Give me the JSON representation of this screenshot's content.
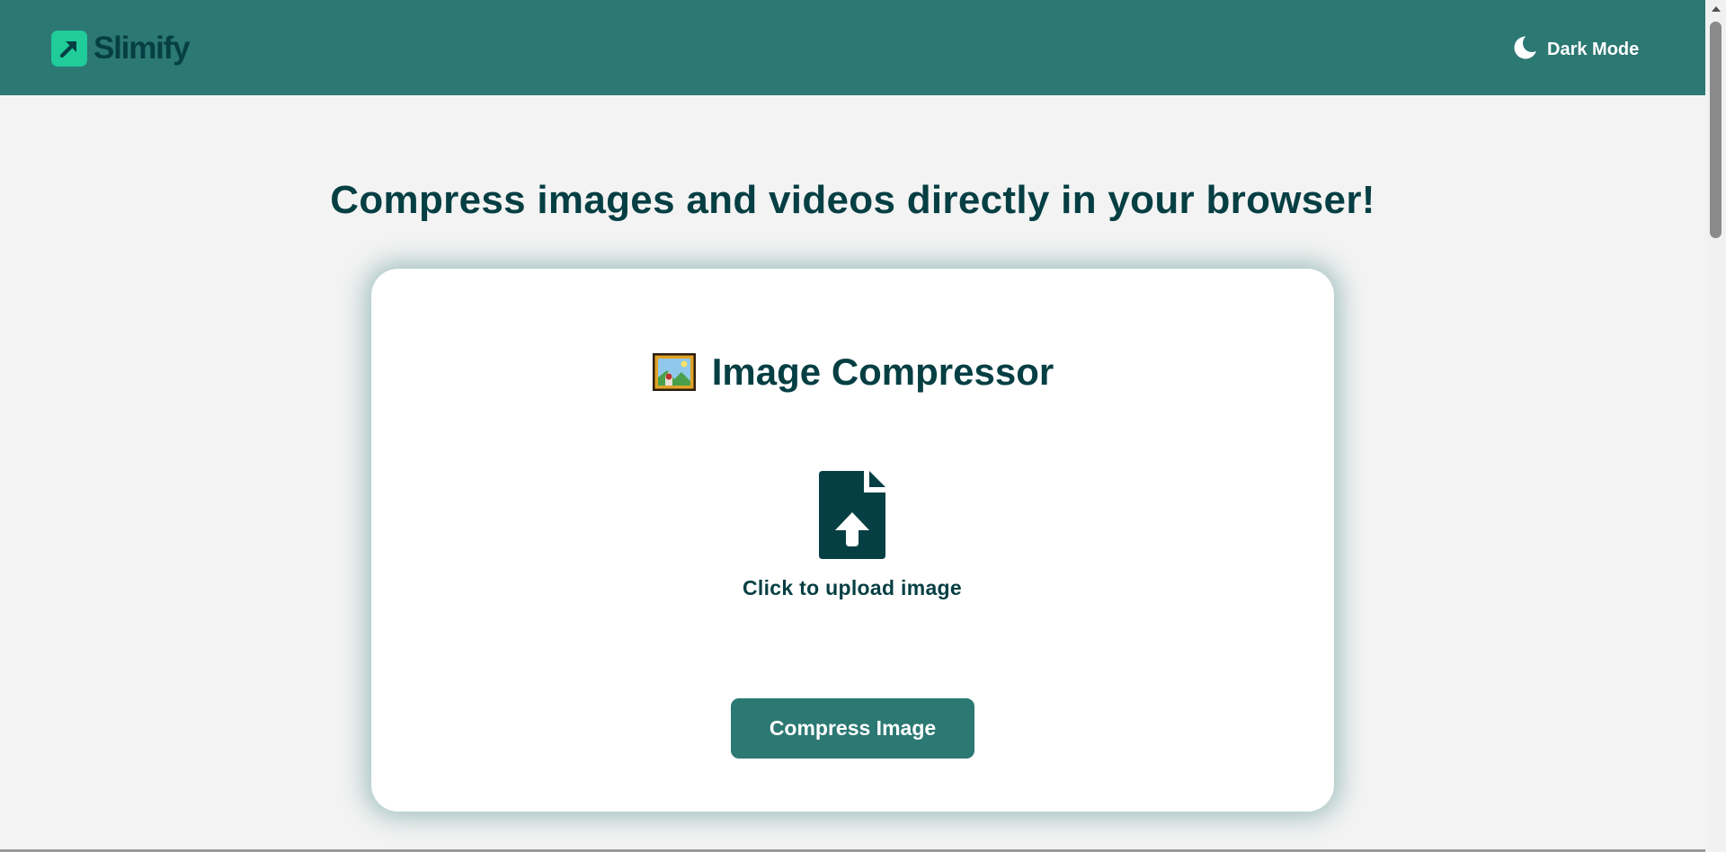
{
  "header": {
    "logo_text": "Slimify",
    "logo_icon": "trending-arrow-icon",
    "dark_mode_label": "Dark Mode",
    "dark_mode_icon": "moon-icon"
  },
  "main": {
    "headline": "Compress images and videos directly in your browser!"
  },
  "compressor": {
    "title": "Image Compressor",
    "title_icon": "framed-picture-icon",
    "upload_label": "Click to upload image",
    "upload_icon": "file-upload-icon",
    "compress_button": "Compress Image"
  },
  "colors": {
    "header_bg": "#2c7873",
    "logo_accent": "#1fcc9a",
    "text_dark": "#063f43",
    "page_bg": "#f3f3f3",
    "card_bg": "#ffffff"
  }
}
